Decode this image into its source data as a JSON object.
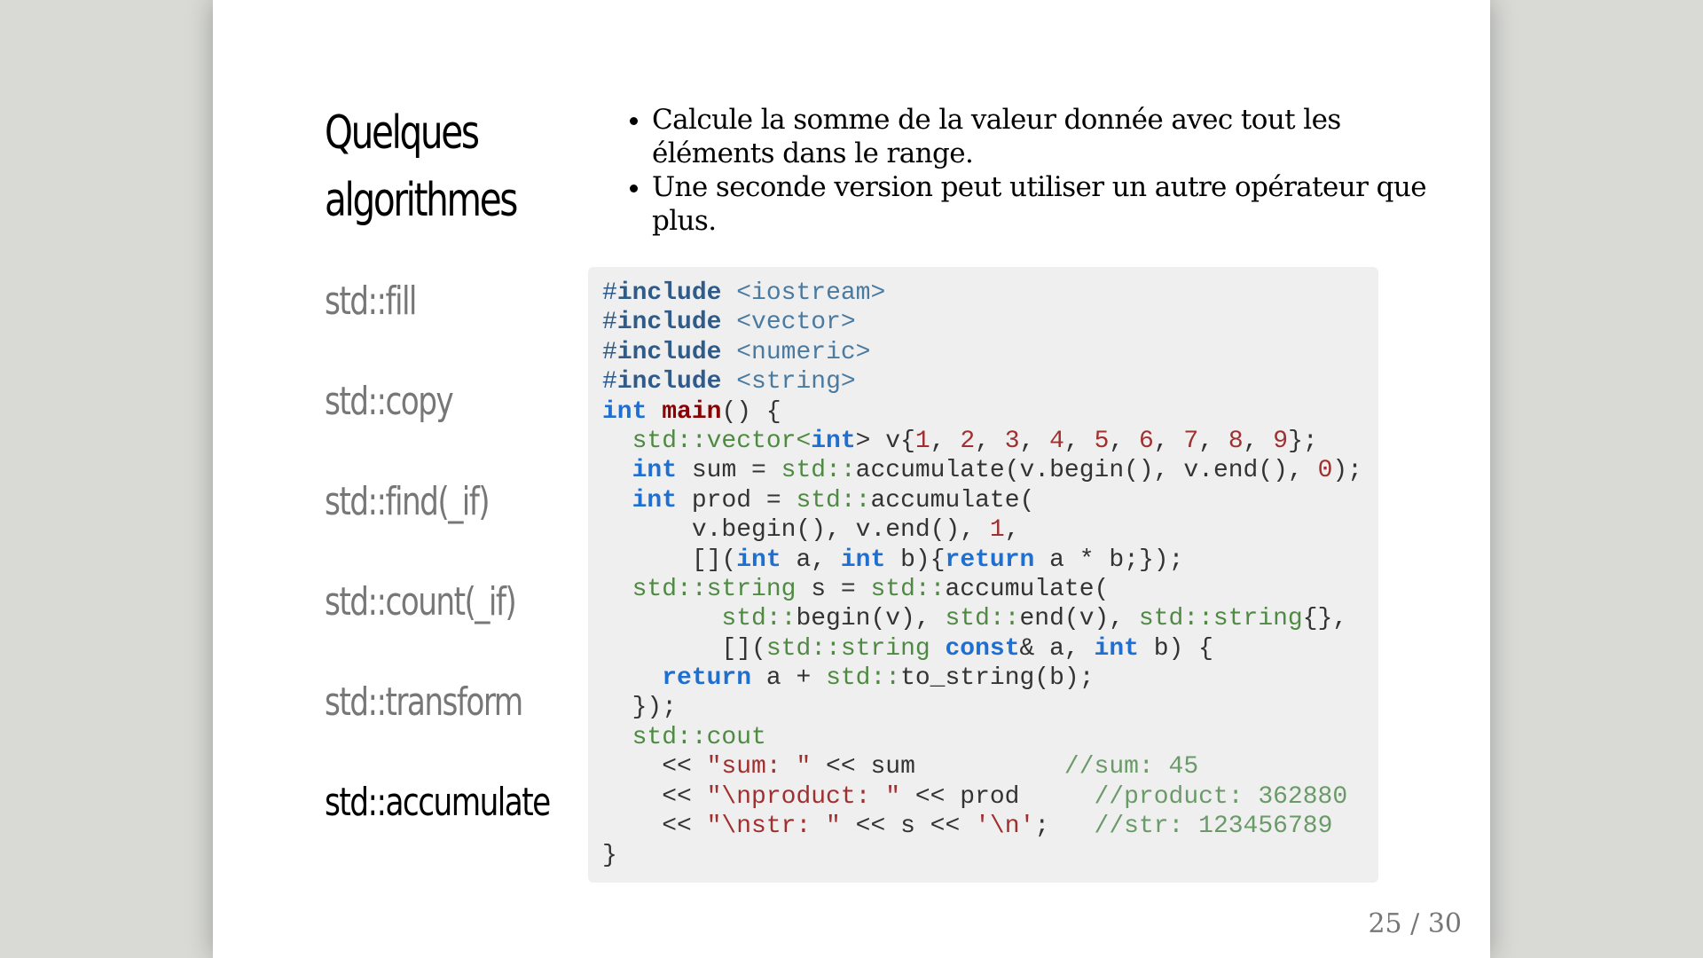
{
  "slide": {
    "title": "Quelques algorithmes",
    "nav": [
      {
        "label": "std::fill",
        "active": false
      },
      {
        "label": "std::copy",
        "active": false
      },
      {
        "label": "std::find(_if)",
        "active": false
      },
      {
        "label": "std::count(_if)",
        "active": false
      },
      {
        "label": "std::transform",
        "active": false
      },
      {
        "label": "std::accumulate",
        "active": true
      }
    ],
    "bullets": [
      "Calcule la somme de la valeur donnée avec tout les éléments dans le range.",
      "Une seconde version peut utiliser un autre opérateur que plus."
    ],
    "code_lines": [
      [
        [
          "pph",
          "#"
        ],
        [
          "pp",
          "include"
        ],
        [
          "t",
          " "
        ],
        [
          "inc",
          "<iostream>"
        ]
      ],
      [
        [
          "pph",
          "#"
        ],
        [
          "pp",
          "include"
        ],
        [
          "t",
          " "
        ],
        [
          "inc",
          "<vector>"
        ]
      ],
      [
        [
          "pph",
          "#"
        ],
        [
          "pp",
          "include"
        ],
        [
          "t",
          " "
        ],
        [
          "inc",
          "<numeric>"
        ]
      ],
      [
        [
          "pph",
          "#"
        ],
        [
          "pp",
          "include"
        ],
        [
          "t",
          " "
        ],
        [
          "inc",
          "<string>"
        ]
      ],
      [
        [
          "kw",
          "int"
        ],
        [
          "t",
          " "
        ],
        [
          "fn",
          "main"
        ],
        [
          "t",
          "() {"
        ]
      ],
      [
        [
          "t",
          "  "
        ],
        [
          "ns",
          "std::vector<"
        ],
        [
          "kw",
          "int"
        ],
        [
          "t",
          "> v{"
        ],
        [
          "num",
          "1"
        ],
        [
          "t",
          ", "
        ],
        [
          "num",
          "2"
        ],
        [
          "t",
          ", "
        ],
        [
          "num",
          "3"
        ],
        [
          "t",
          ", "
        ],
        [
          "num",
          "4"
        ],
        [
          "t",
          ", "
        ],
        [
          "num",
          "5"
        ],
        [
          "t",
          ", "
        ],
        [
          "num",
          "6"
        ],
        [
          "t",
          ", "
        ],
        [
          "num",
          "7"
        ],
        [
          "t",
          ", "
        ],
        [
          "num",
          "8"
        ],
        [
          "t",
          ", "
        ],
        [
          "num",
          "9"
        ],
        [
          "t",
          "};"
        ]
      ],
      [
        [
          "t",
          "  "
        ],
        [
          "kw",
          "int"
        ],
        [
          "t",
          " sum = "
        ],
        [
          "ns",
          "std::"
        ],
        [
          "t",
          "accumulate(v.begin(), v.end(), "
        ],
        [
          "num",
          "0"
        ],
        [
          "t",
          ");"
        ]
      ],
      [
        [
          "t",
          "  "
        ],
        [
          "kw",
          "int"
        ],
        [
          "t",
          " prod = "
        ],
        [
          "ns",
          "std::"
        ],
        [
          "t",
          "accumulate("
        ]
      ],
      [
        [
          "t",
          "      v.begin(), v.end(), "
        ],
        [
          "num",
          "1"
        ],
        [
          "t",
          ","
        ]
      ],
      [
        [
          "t",
          "      []("
        ],
        [
          "kw",
          "int"
        ],
        [
          "t",
          " a, "
        ],
        [
          "kw",
          "int"
        ],
        [
          "t",
          " b){"
        ],
        [
          "kw",
          "return"
        ],
        [
          "t",
          " a * b;});"
        ]
      ],
      [
        [
          "t",
          "  "
        ],
        [
          "ns",
          "std::string"
        ],
        [
          "t",
          " s = "
        ],
        [
          "ns",
          "std::"
        ],
        [
          "t",
          "accumulate("
        ]
      ],
      [
        [
          "t",
          "        "
        ],
        [
          "ns",
          "std::"
        ],
        [
          "t",
          "begin(v), "
        ],
        [
          "ns",
          "std::"
        ],
        [
          "t",
          "end(v), "
        ],
        [
          "ns",
          "std::string"
        ],
        [
          "t",
          "{},"
        ]
      ],
      [
        [
          "t",
          "        []("
        ],
        [
          "ns",
          "std::string"
        ],
        [
          "t",
          " "
        ],
        [
          "kw",
          "const"
        ],
        [
          "t",
          "& a, "
        ],
        [
          "kw",
          "int"
        ],
        [
          "t",
          " b) {"
        ]
      ],
      [
        [
          "t",
          "    "
        ],
        [
          "kw",
          "return"
        ],
        [
          "t",
          " a + "
        ],
        [
          "ns",
          "std::"
        ],
        [
          "t",
          "to_string(b);"
        ]
      ],
      [
        [
          "t",
          "  });"
        ]
      ],
      [
        [
          "t",
          "  "
        ],
        [
          "ns",
          "std::cout"
        ]
      ],
      [
        [
          "t",
          "    << "
        ],
        [
          "str",
          "\"sum: \""
        ],
        [
          "t",
          " << sum          "
        ],
        [
          "com",
          "//sum: 45"
        ]
      ],
      [
        [
          "t",
          "    << "
        ],
        [
          "str",
          "\"\\nproduct: \""
        ],
        [
          "t",
          " << prod     "
        ],
        [
          "com",
          "//product: 362880"
        ]
      ],
      [
        [
          "t",
          "    << "
        ],
        [
          "str",
          "\"\\nstr: \""
        ],
        [
          "t",
          " << s << "
        ],
        [
          "str",
          "'\\n'"
        ],
        [
          "t",
          ";   "
        ],
        [
          "com",
          "//str: 123456789"
        ]
      ],
      [
        [
          "t",
          "}"
        ]
      ]
    ],
    "page_number": "25 / 30"
  }
}
